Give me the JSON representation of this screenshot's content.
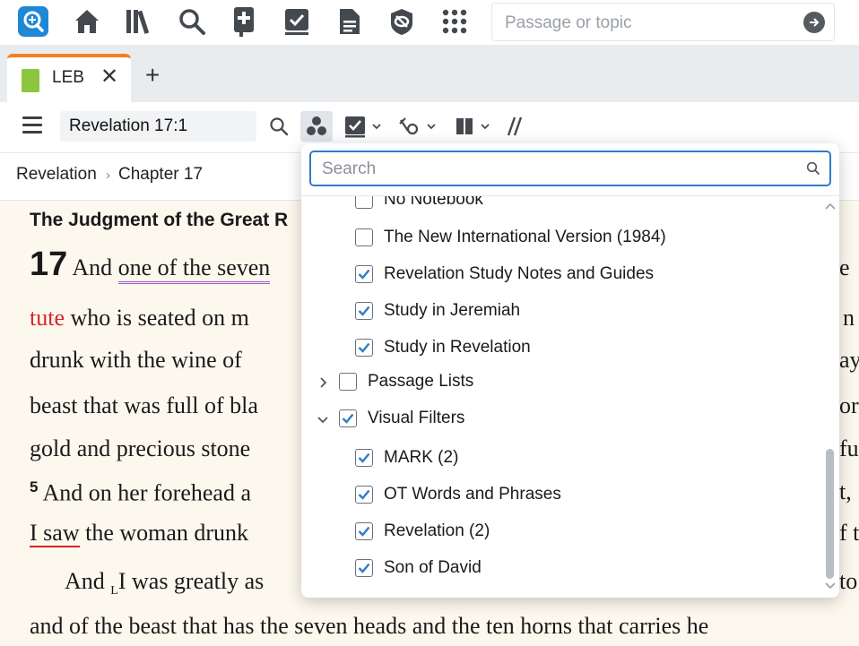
{
  "topbar": {
    "icons": [
      "logos-home-search-icon",
      "home-icon",
      "library-icon",
      "search-icon",
      "add-resource-icon",
      "checklist-icon",
      "document-icon",
      "shield-icon",
      "apps-grid-icon"
    ],
    "passage_placeholder": "Passage or topic"
  },
  "tabs": [
    {
      "label": "LEB"
    }
  ],
  "panel_toolbar": {
    "reference": "Revelation 17:1"
  },
  "breadcrumb": {
    "book": "Revelation",
    "separator": "›",
    "chapter": "Chapter 17"
  },
  "content": {
    "heading": "The Judgment of the Great R",
    "chapter_number": "17",
    "lines": [
      {
        "pre": "And ",
        "underlined": "one of the seven",
        "post": ""
      },
      {
        "red": "tute",
        "post": " who is seated on m"
      },
      {
        "post": "drunk with the wine of"
      },
      {
        "post": "beast that was full of bla"
      },
      {
        "post": "gold and precious stone"
      },
      {
        "verse": "5",
        "post": " And on her forehead a"
      },
      {
        "underlined": "I saw",
        "post": " the woman drunk"
      },
      {
        "post": "And ",
        "sub": "L",
        "post2": "I was greatly as"
      },
      {
        "post": "and of the beast that has the seven heads and the ten horns that carries he"
      }
    ],
    "right_fragments": [
      "e",
      "n",
      "ay",
      "or",
      "fu",
      "t,",
      "f t",
      "to"
    ]
  },
  "dropdown": {
    "search_placeholder": "Search",
    "partial_top_item": "No Notebook",
    "items": [
      {
        "label": "The New International Version (1984)",
        "checked": false,
        "level": 2
      },
      {
        "label": "Revelation Study Notes and Guides",
        "checked": true,
        "level": 2
      },
      {
        "label": "Study in Jeremiah",
        "checked": true,
        "level": 2
      },
      {
        "label": "Study in Revelation",
        "checked": true,
        "level": 2
      },
      {
        "label": "Passage Lists",
        "checked": false,
        "level": 1,
        "expander": "collapsed"
      },
      {
        "label": "Visual Filters",
        "checked": true,
        "level": 1,
        "expander": "expanded"
      },
      {
        "label": "MARK (2)",
        "checked": true,
        "level": 2
      },
      {
        "label": "OT Words and Phrases",
        "checked": true,
        "level": 2
      },
      {
        "label": "Revelation (2)",
        "checked": true,
        "level": 2
      },
      {
        "label": "Son of David",
        "checked": true,
        "level": 2
      }
    ]
  },
  "colors": {
    "accent": "#2f7cc9",
    "tab_accent": "#f47f1f",
    "red_text": "#d8232a",
    "page_bg": "#fdf8ee"
  }
}
